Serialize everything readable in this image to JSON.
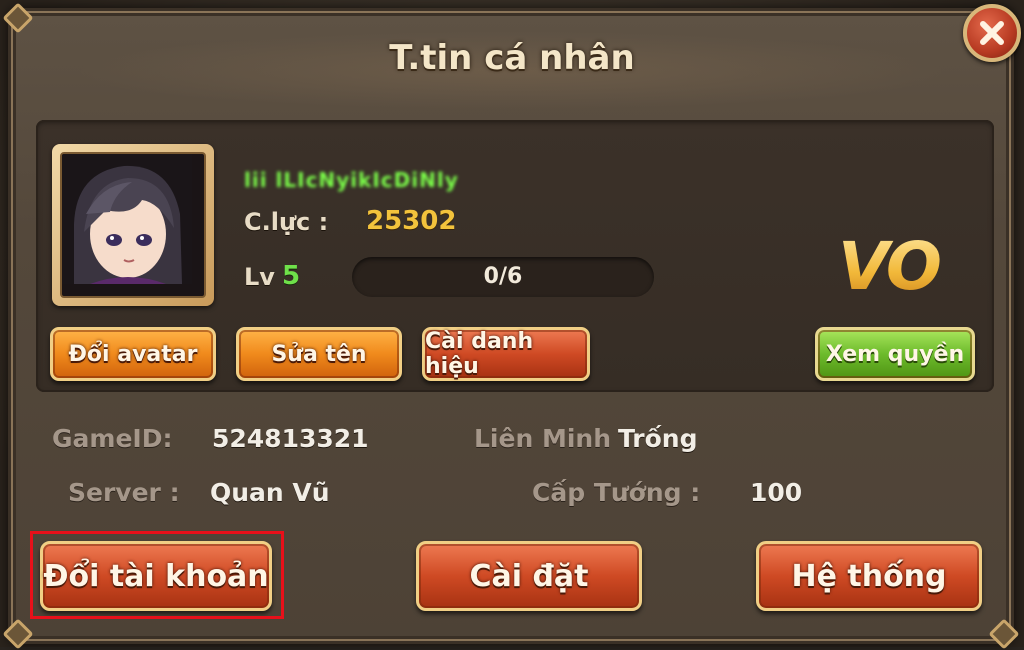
{
  "dialog": {
    "title": "T.tin cá nhân"
  },
  "profile": {
    "player_name": "lii lLIcNyikIcDiNly",
    "combat_label": "C.lực :",
    "combat_value": "25302",
    "level_label": "Lv",
    "level_value": "5",
    "exp_text": "0/6",
    "exp_progress": 0.0,
    "vip_text": "VO"
  },
  "profile_buttons": {
    "change_avatar": "Đổi avatar",
    "rename": "Sửa tên",
    "set_title": "Cài danh hiệu",
    "view_rights": "Xem quyền"
  },
  "info": {
    "gameid_label": "GameID:",
    "gameid_value": "524813321",
    "alliance_label": "Liên Minh",
    "alliance_value": "Trống",
    "server_label": "Server :",
    "server_value": "Quan Vũ",
    "general_level_label": "Cấp Tướng :",
    "general_level_value": "100"
  },
  "bottom_buttons": {
    "switch_account": "Đổi tài khoản",
    "settings": "Cài đặt",
    "system": "Hệ thống"
  },
  "icons": {
    "close": "close-icon",
    "avatar": "character-portrait"
  },
  "colors": {
    "highlight": "#e8101a",
    "gold": "#f3c33c",
    "level_green": "#6fe04a"
  }
}
